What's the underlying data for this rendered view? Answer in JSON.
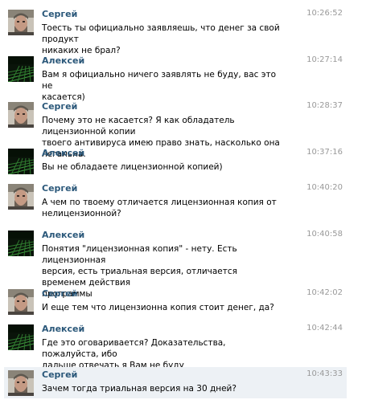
{
  "messages": [
    {
      "author": "Сергей",
      "time": "10:26:52",
      "text": "Тоесть ты официально заявляешь, что денег за свой продукт\nникаких не брал?",
      "avatar": "sergey-avatar"
    },
    {
      "author": "Алексей",
      "time": "10:27:14",
      "text": "Вам я официально ничего заявлять не буду, вас это не\nкасается)",
      "avatar": "alexey-avatar"
    },
    {
      "author": "Сергей",
      "time": "10:28:37",
      "text": "Почему это не касается? Я как обладатель лицензионной копии\nтвоего антивируса имею право знать, насколько она легальна.",
      "avatar": "sergey-avatar"
    },
    {
      "author": "Алексей",
      "time": "10:37:16",
      "text": "Вы не обладаете лицензионной копией)",
      "avatar": "alexey-avatar"
    },
    {
      "author": "Сергей",
      "time": "10:40:20",
      "text": "А чем по твоему отличается лицензионная копия от\nнелицензионной?",
      "avatar": "sergey-avatar"
    },
    {
      "author": "Алексей",
      "time": "10:40:58",
      "text": "Понятия \"лицензионная копия\" - нету. Есть лицензионная\nверсия, есть триальная версия, отличается временем действия\nпрограммы",
      "avatar": "alexey-avatar"
    },
    {
      "author": "Сергей",
      "time": "10:42:02",
      "text": "И еще тем что лицензионна копия стоит денег, да?",
      "avatar": "sergey-avatar"
    },
    {
      "author": "Алексей",
      "time": "10:42:44",
      "text": "Где это оговаривается? Доказательства, пожалуйста, ибо\nдальше отвечать я Вам не буду",
      "avatar": "alexey-avatar"
    },
    {
      "author": "Сергей",
      "time": "10:43:33",
      "text": "Зачем тогда триальная версия на 30 дней?",
      "avatar": "sergey-avatar"
    }
  ],
  "colors": {
    "author_link": "#2b587a",
    "timestamp": "#999999",
    "highlight_bg": "#edf1f5"
  }
}
